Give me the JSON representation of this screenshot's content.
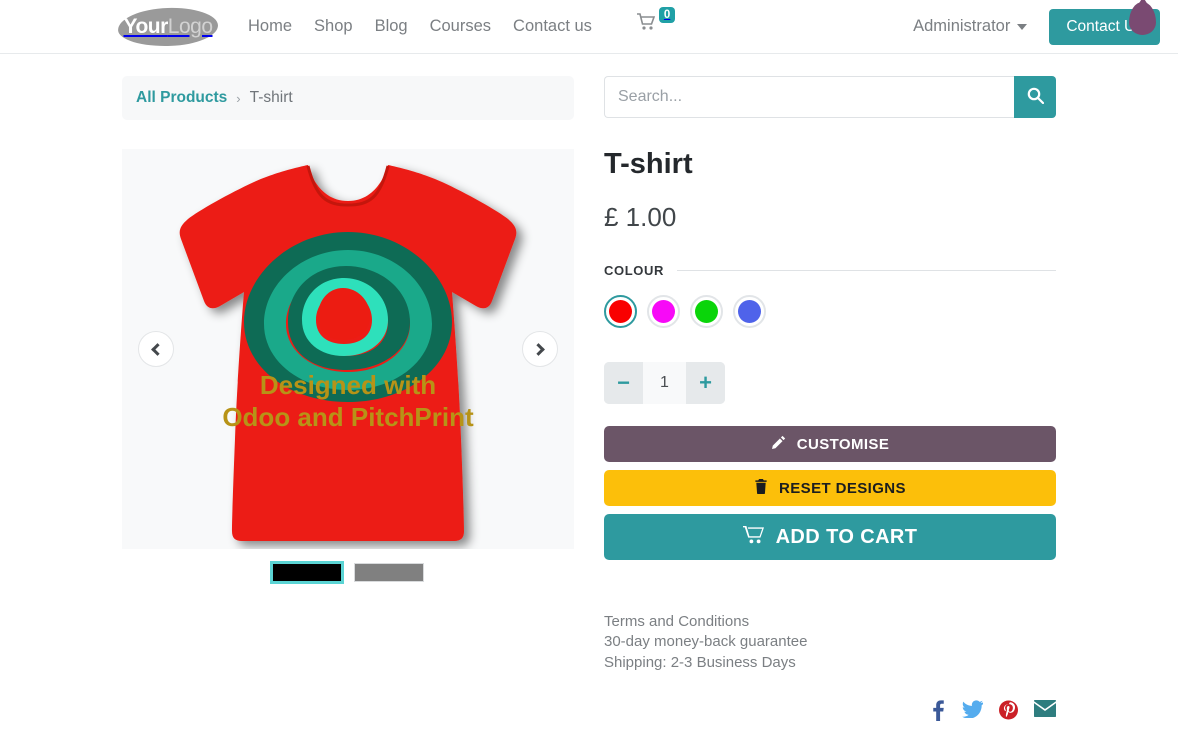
{
  "header": {
    "logo": {
      "bold_part": "Your",
      "light_part": "Logo",
      "icon": "logo-blob"
    },
    "nav": [
      {
        "label": "Home"
      },
      {
        "label": "Shop"
      },
      {
        "label": "Blog"
      },
      {
        "label": "Courses"
      },
      {
        "label": "Contact us"
      }
    ],
    "cart": {
      "icon": "shopping-cart-icon",
      "count": "0"
    },
    "user_menu": {
      "label": "Administrator",
      "icon": "chevron-down-icon"
    },
    "contact_button": {
      "label": "Contact Us"
    },
    "decoration": {
      "icon": "teardrop-icon",
      "color": "#7a4a72"
    }
  },
  "breadcrumb": {
    "root": "All Products",
    "separator": "›",
    "current": "T-shirt"
  },
  "search": {
    "placeholder": "Search...",
    "value": "",
    "button_icon": "search-icon"
  },
  "carousel": {
    "prev_icon": "chevron-left-icon",
    "next_icon": "chevron-right-icon",
    "image_alt": "red-tshirt-with-design",
    "design_text_line1": "Designed with",
    "design_text_line2": "Odoo and PitchPrint",
    "thumbnails": [
      {
        "name": "thumbnail-black",
        "color": "#000000",
        "selected": true
      },
      {
        "name": "thumbnail-grey",
        "color": "#808080",
        "selected": false
      }
    ]
  },
  "product": {
    "title": "T-shirt",
    "price": "£ 1.00",
    "colour_label": "COLOUR",
    "colours": [
      {
        "name": "red",
        "hex": "#f90000",
        "selected": true
      },
      {
        "name": "magenta",
        "hex": "#f70af7",
        "selected": false
      },
      {
        "name": "green",
        "hex": "#0ad50a",
        "selected": false
      },
      {
        "name": "blue",
        "hex": "#4f63ea",
        "selected": false
      }
    ],
    "quantity": {
      "decrease_label": "−",
      "value": "1",
      "increase_label": "+"
    },
    "buttons": {
      "customise": {
        "label": "CUSTOMISE",
        "icon": "pencil-icon",
        "color": "#6b5567"
      },
      "reset": {
        "label": "RESET DESIGNS",
        "icon": "trash-icon",
        "color": "#fcbf0a"
      },
      "add_to_cart": {
        "label": "ADD TO CART",
        "icon": "cart-icon",
        "color": "#2e9a9f"
      }
    }
  },
  "terms": {
    "line1": "Terms and Conditions",
    "line2": "30-day money-back guarantee",
    "line3": "Shipping: 2-3 Business Days"
  },
  "socials": [
    {
      "name": "facebook",
      "icon": "facebook-icon",
      "color": "#3b5998"
    },
    {
      "name": "twitter",
      "icon": "twitter-icon",
      "color": "#55acee"
    },
    {
      "name": "pinterest",
      "icon": "pinterest-icon",
      "color": "#cb2027"
    },
    {
      "name": "email",
      "icon": "envelope-icon",
      "color": "#2e7d7f"
    }
  ]
}
